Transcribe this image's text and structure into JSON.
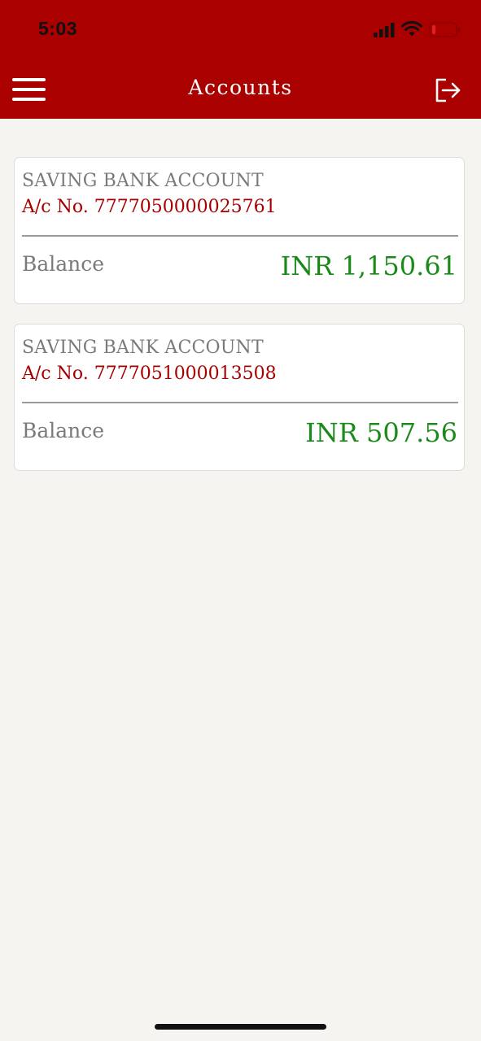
{
  "status_bar": {
    "time": "5:03"
  },
  "header": {
    "title": "Accounts",
    "menu_icon": "hamburger-menu-icon",
    "logout_icon": "logout-icon",
    "background_color": "#aa0000"
  },
  "accounts": [
    {
      "type": "SAVING BANK ACCOUNT",
      "account_number": "A/c No. 7777050000025761",
      "balance_label": "Balance",
      "balance": "INR 1,150.61"
    },
    {
      "type": "SAVING BANK ACCOUNT",
      "account_number": "A/c No. 7777051000013508",
      "balance_label": "Balance",
      "balance": "INR 507.56"
    }
  ],
  "colors": {
    "accent": "#aa0000",
    "balance_green": "#1a8a1a",
    "muted_text": "#7a7a7a"
  }
}
